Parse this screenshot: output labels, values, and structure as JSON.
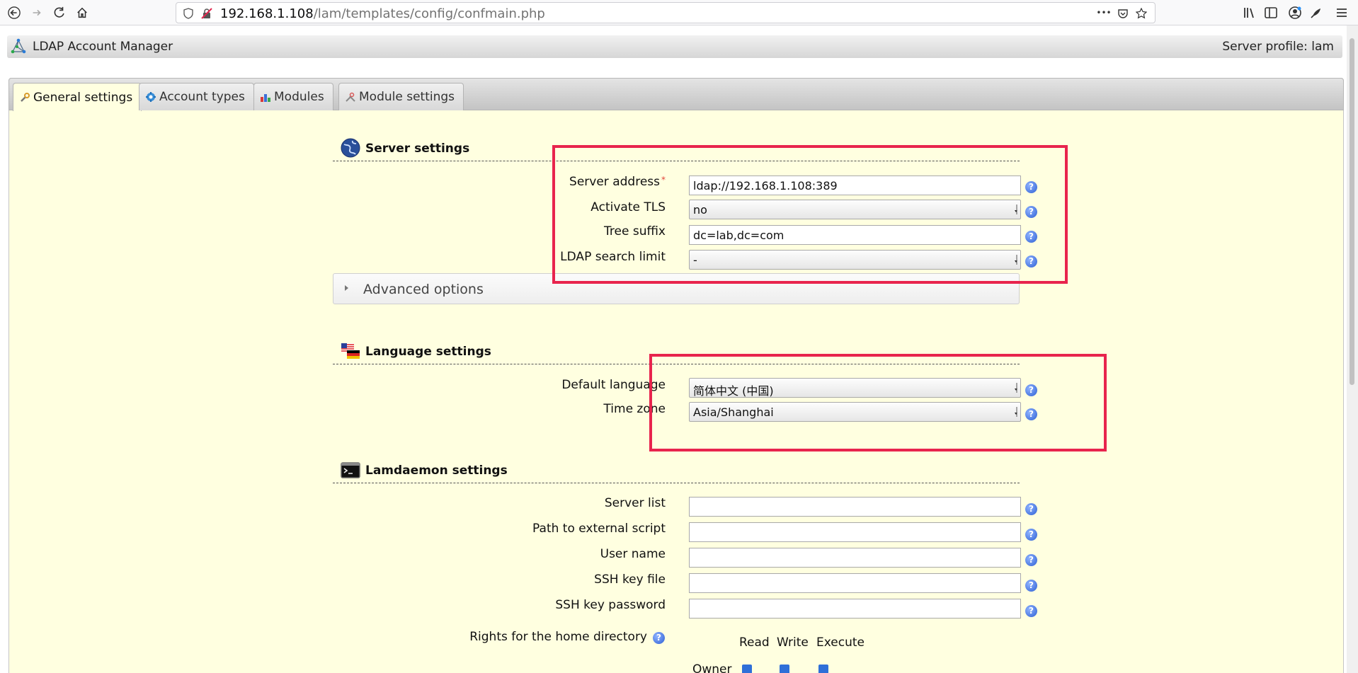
{
  "browser": {
    "url_host": "192.168.1.108",
    "url_path": "/lam/templates/config/confmain.php",
    "menu_dots": "•••"
  },
  "app": {
    "title": "LDAP Account Manager",
    "server_profile": "Server profile: lam"
  },
  "tabs": [
    {
      "label": "General settings",
      "icon": "wrench-icon",
      "active": true
    },
    {
      "label": "Account types",
      "icon": "gear-icon",
      "active": false
    },
    {
      "label": "Modules",
      "icon": "modules-icon",
      "active": false
    },
    {
      "label": "Module settings",
      "icon": "tools-icon",
      "active": false
    }
  ],
  "server_settings": {
    "title": "Server settings",
    "server_address_label": "Server address",
    "required_mark": "*",
    "server_address_value": "ldap://192.168.1.108:389",
    "activate_tls_label": "Activate TLS",
    "activate_tls_value": "no",
    "tree_suffix_label": "Tree suffix",
    "tree_suffix_value": "dc=lab,dc=com",
    "search_limit_label": "LDAP search limit",
    "search_limit_value": "-",
    "advanced_options": "Advanced options"
  },
  "language_settings": {
    "title": "Language settings",
    "default_language_label": "Default language",
    "default_language_value": "简体中文 (中国)",
    "time_zone_label": "Time zone",
    "time_zone_value": "Asia/Shanghai"
  },
  "lamdaemon_settings": {
    "title": "Lamdaemon settings",
    "server_list_label": "Server list",
    "external_script_label": "Path to external script",
    "user_name_label": "User name",
    "ssh_key_file_label": "SSH key file",
    "ssh_key_password_label": "SSH key password",
    "rights_label": "Rights for the home directory",
    "rights_columns": [
      "Read",
      "Write",
      "Execute"
    ],
    "owner_label": "Owner"
  },
  "help_glyph": "?",
  "colors": {
    "panel_bg": "#ffffe0",
    "highlight": "#e8244d",
    "help_icon": "#2d5fd3"
  }
}
